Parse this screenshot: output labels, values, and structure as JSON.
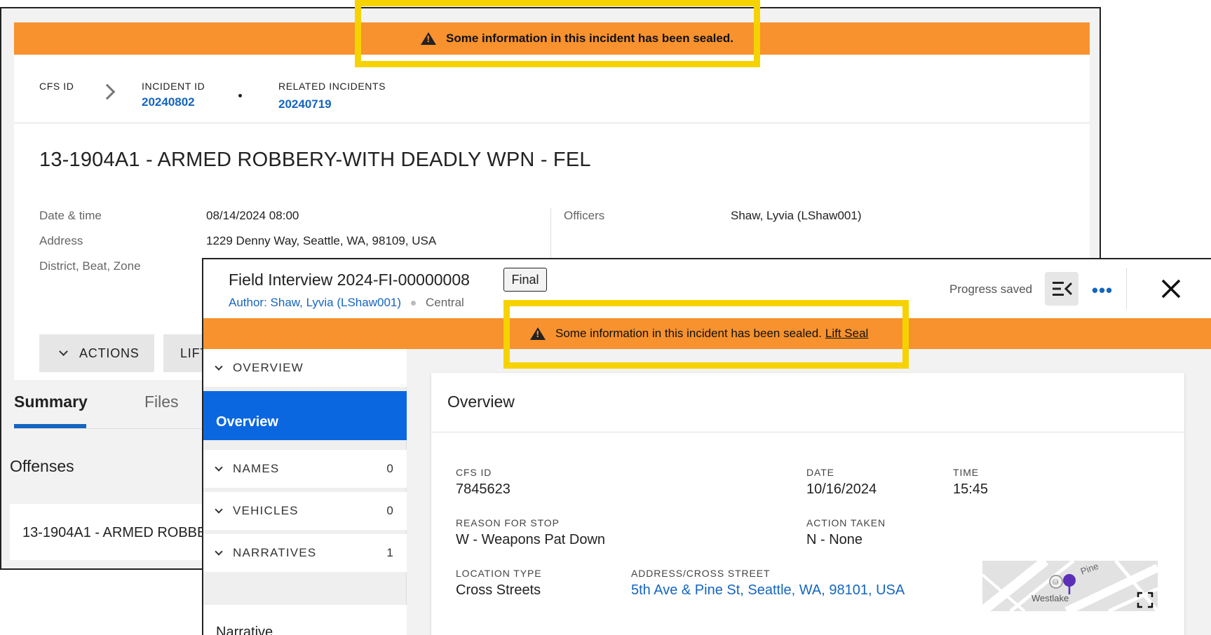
{
  "background_incident": {
    "banner_text": "Some information in this incident has been sealed.",
    "ids": [
      {
        "label": "CFS ID",
        "value": ""
      },
      {
        "label": "INCIDENT ID",
        "value": "20240802"
      },
      {
        "label": "RELATED INCIDENTS",
        "value": "20240719"
      }
    ],
    "title": "13-1904A1 - ARMED ROBBERY-WITH DEADLY WPN - FEL",
    "details": [
      {
        "label": "Date & time",
        "value": "08/14/2024 08:00"
      },
      {
        "label": "Address",
        "value": "1229 Denny Way, Seattle, WA, 98109, USA"
      },
      {
        "label": "District, Beat, Zone",
        "value": ""
      }
    ],
    "officers_label": "Officers",
    "officers_value": "Shaw, Lyvia (LShaw001)",
    "actions_button": "ACTIONS",
    "lift_button_partial": "LIFT",
    "tabs": [
      "Summary",
      "Files"
    ],
    "offenses_heading": "Offenses",
    "offense_item": "13-1904A1 - ARMED ROBBE"
  },
  "field_interview": {
    "title": "Field Interview 2024-FI-00000008",
    "status_badge": "Final",
    "author": "Author: Shaw, Lyvia (LShaw001)",
    "district": "Central",
    "progress_text": "Progress saved",
    "banner_text": "Some information in this incident has been sealed.",
    "banner_link": "Lift Seal",
    "sidebar": {
      "overview_section": "OVERVIEW",
      "overview_item": "Overview",
      "sections": [
        {
          "label": "NAMES",
          "count": "0"
        },
        {
          "label": "VEHICLES",
          "count": "0"
        },
        {
          "label": "NARRATIVES",
          "count": "1"
        }
      ],
      "narrative_item": "Narrative"
    },
    "overview": {
      "heading": "Overview",
      "fields": {
        "cfs_id": {
          "label": "CFS ID",
          "value": "7845623"
        },
        "date": {
          "label": "DATE",
          "value": "10/16/2024"
        },
        "time": {
          "label": "TIME",
          "value": "15:45"
        },
        "reason": {
          "label": "REASON FOR STOP",
          "value": "W - Weapons Pat Down"
        },
        "action": {
          "label": "ACTION TAKEN",
          "value": "N - None"
        },
        "location_type": {
          "label": "LOCATION TYPE",
          "value": "Cross Streets"
        },
        "address": {
          "label": "ADDRESS/CROSS STREET",
          "value": "5th Ave & Pine St, Seattle, WA, 98101, USA"
        }
      },
      "map": {
        "street_label": "Pine",
        "place_label": "Westlake"
      }
    }
  },
  "colors": {
    "banner_orange": "#f7922e",
    "highlight_yellow": "#f6d300",
    "link_blue": "#1565c0",
    "active_blue": "#0b67e0"
  }
}
